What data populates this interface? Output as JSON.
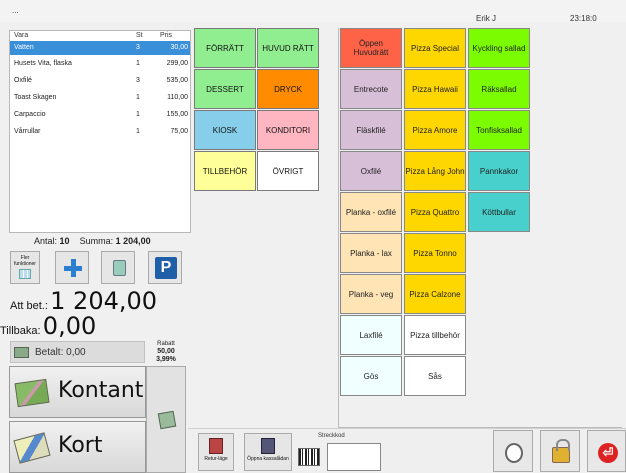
{
  "header": {
    "title": "...",
    "user": "Erik J",
    "clock": "23:18:0"
  },
  "order": {
    "columns": {
      "name": "Vara",
      "qty": "St",
      "price": "Pris"
    },
    "rows": [
      {
        "name": "Vatten",
        "qty": "3",
        "price": "30,00",
        "selected": true
      },
      {
        "name": "Husets Vita, flaska",
        "qty": "1",
        "price": "299,00"
      },
      {
        "name": "Oxfilé",
        "qty": "3",
        "price": "535,00"
      },
      {
        "name": "Toast Skagen",
        "qty": "1",
        "price": "110,00"
      },
      {
        "name": "Carpaccio",
        "qty": "1",
        "price": "155,00"
      },
      {
        "name": "Vårrullar",
        "qty": "1",
        "price": "75,00"
      }
    ]
  },
  "summary": {
    "antal_label": "Antal:",
    "antal_value": "10",
    "summa_label": "Summa:",
    "summa_value": "1 204,00"
  },
  "tools": {
    "fler_label": "Fler funktioner",
    "parking_label": "P"
  },
  "totals": {
    "att_bet_label": "Att bet.:",
    "att_bet_value": "1 204,00",
    "tillbaka_label": "Tillbaka:",
    "tillbaka_value": "0,00",
    "betalt_label": "Betalt: 0,00",
    "rabatt_label": "Rabatt",
    "rabatt_amount": "50,00",
    "rabatt_percent": "3,99%"
  },
  "payment": {
    "kontant": "Kontant",
    "kort": "Kort"
  },
  "categories": [
    {
      "label": "FÖRRÄTT",
      "color": "#90ee90"
    },
    {
      "label": "HUVUD RÄTT",
      "color": "#90ee90"
    },
    {
      "label": "DESSERT",
      "color": "#90ee90"
    },
    {
      "label": "DRYCK",
      "color": "#ff8c00"
    },
    {
      "label": "KIOSK",
      "color": "#87ceeb"
    },
    {
      "label": "KONDITORI",
      "color": "#ffb6c1"
    },
    {
      "label": "TILLBEHÖR",
      "color": "#ffff99"
    },
    {
      "label": "ÖVRIGT",
      "color": "#ffffff"
    }
  ],
  "products": {
    "col1": [
      {
        "label": "Öppen Huvudrätt",
        "color": "#ff6347"
      },
      {
        "label": "Entrecote",
        "color": "#d8bfd8"
      },
      {
        "label": "Fläskfilé",
        "color": "#d8bfd8"
      },
      {
        "label": "Oxfilé",
        "color": "#d8bfd8"
      },
      {
        "label": "Planka - oxfilé",
        "color": "#ffe4b5"
      },
      {
        "label": "Planka - lax",
        "color": "#ffe4b5"
      },
      {
        "label": "Planka - veg",
        "color": "#ffe4b5"
      },
      {
        "label": "Laxfilé",
        "color": "#f0ffff"
      },
      {
        "label": "Gös",
        "color": "#f0ffff"
      }
    ],
    "col2": [
      {
        "label": "Pizza Special",
        "color": "#ffd700"
      },
      {
        "label": "Pizza Hawaii",
        "color": "#ffd700"
      },
      {
        "label": "Pizza Amore",
        "color": "#ffd700"
      },
      {
        "label": "Pizza Lång John",
        "color": "#ffd700"
      },
      {
        "label": "Pizza Quattro",
        "color": "#ffd700"
      },
      {
        "label": "Pizza Tonno",
        "color": "#ffd700"
      },
      {
        "label": "Pizza Calzone",
        "color": "#ffd700"
      },
      {
        "label": "Pizza tillbehör",
        "color": "#ffffff"
      },
      {
        "label": "Sås",
        "color": "#ffffff"
      }
    ],
    "col3": [
      {
        "label": "Kyckling sallad",
        "color": "#7cfc00"
      },
      {
        "label": "Räksallad",
        "color": "#7cfc00"
      },
      {
        "label": "Tonfisksallad",
        "color": "#7cfc00"
      },
      {
        "label": "Pannkakor",
        "color": "#48d1cc"
      },
      {
        "label": "Köttbullar",
        "color": "#48d1cc"
      }
    ]
  },
  "bottom": {
    "retur": "Retur-läge",
    "oppna": "Öppna kassalådan",
    "streckkod": "Streckkod"
  }
}
